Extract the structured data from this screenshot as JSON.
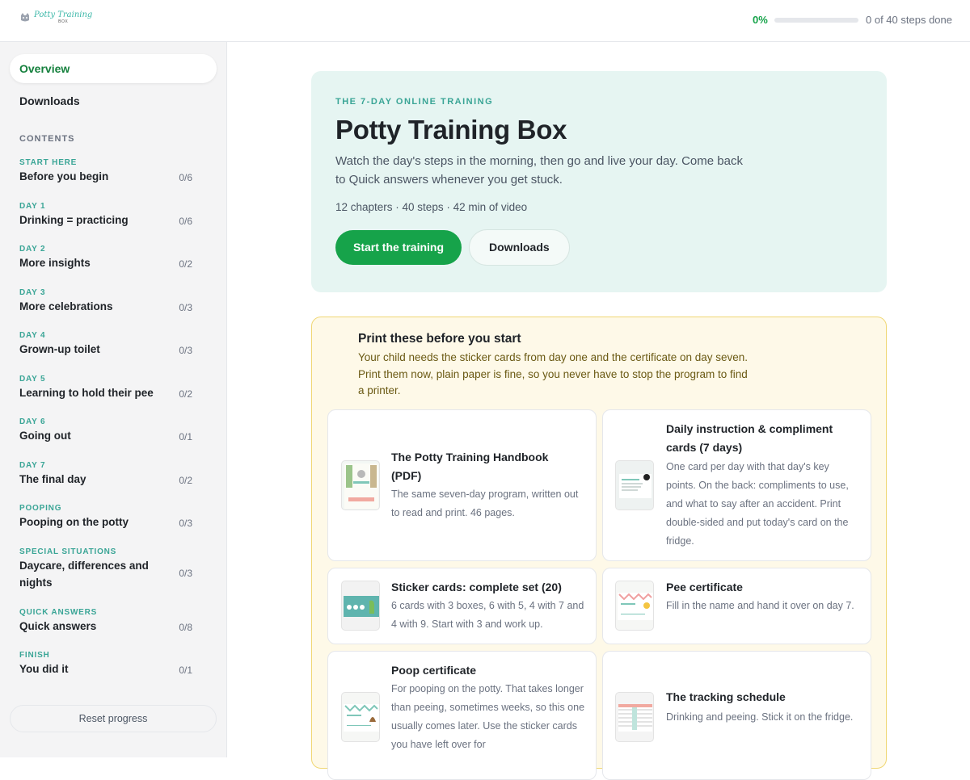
{
  "header": {
    "logo_script": "Potty Training",
    "logo_sub": "BOX",
    "progress_percent_label": "0%",
    "progress_fraction": 0,
    "progress_count": "0 of 40 steps done"
  },
  "sidebar": {
    "overview": "Overview",
    "downloads": "Downloads",
    "contents_label": "CONTENTS",
    "items": [
      {
        "kicker": "START HERE",
        "title": "Before you begin",
        "count": "0/6"
      },
      {
        "kicker": "DAY 1",
        "title": "Drinking = practicing",
        "count": "0/6"
      },
      {
        "kicker": "DAY 2",
        "title": "More insights",
        "count": "0/2"
      },
      {
        "kicker": "DAY 3",
        "title": "More celebrations",
        "count": "0/3"
      },
      {
        "kicker": "DAY 4",
        "title": "Grown-up toilet",
        "count": "0/3"
      },
      {
        "kicker": "DAY 5",
        "title": "Learning to hold their pee",
        "count": "0/2"
      },
      {
        "kicker": "DAY 6",
        "title": "Going out",
        "count": "0/1"
      },
      {
        "kicker": "DAY 7",
        "title": "The final day",
        "count": "0/2"
      },
      {
        "kicker": "POOPING",
        "title": "Pooping on the potty",
        "count": "0/3"
      },
      {
        "kicker": "SPECIAL SITUATIONS",
        "title": "Daycare, differences and nights",
        "count": "0/3"
      },
      {
        "kicker": "QUICK ANSWERS",
        "title": "Quick answers",
        "count": "0/8"
      },
      {
        "kicker": "FINISH",
        "title": "You did it",
        "count": "0/1"
      }
    ],
    "reset": "Reset progress"
  },
  "hero": {
    "kicker": "THE 7-DAY ONLINE TRAINING",
    "title": "Potty Training Box",
    "description": "Watch the day's steps in the morning, then go and live your day. Come back to Quick answers whenever you get stuck.",
    "meta": "12 chapters · 40 steps · 42 min of video",
    "start_button": "Start the training",
    "downloads_button": "Downloads"
  },
  "print": {
    "title": "Print these before you start",
    "description": "Your child needs the sticker cards from day one and the certificate on day seven. Print them now, plain paper is fine, so you never have to stop the program to find a printer.",
    "cards": [
      {
        "title": "The Potty Training Handbook (PDF)",
        "description": "The same seven-day program, written out to read and print. 46 pages."
      },
      {
        "title": "Daily instruction & compliment cards (7 days)",
        "description": "One card per day with that day's key points. On the back: compliments to use, and what to say after an accident. Print double-sided and put today's card on the fridge."
      },
      {
        "title": "Sticker cards: complete set (20)",
        "description": "6 cards with 3 boxes, 6 with 5, 4 with 7 and 4 with 9. Start with 3 and work up."
      },
      {
        "title": "Pee certificate",
        "description": "Fill in the name and hand it over on day 7."
      },
      {
        "title": "Poop certificate",
        "description": "For pooping on the potty. That takes longer than peeing, sometimes weeks, so this one usually comes later. Use the sticker cards you have left over for"
      },
      {
        "title": "The tracking schedule",
        "description": "Drinking and peeing. Stick it on the fridge."
      }
    ]
  },
  "colors": {
    "accent_green": "#16a34a",
    "teal": "#3aa596",
    "hero_bg": "#e6f5f2",
    "print_bg": "#fef9e8"
  }
}
